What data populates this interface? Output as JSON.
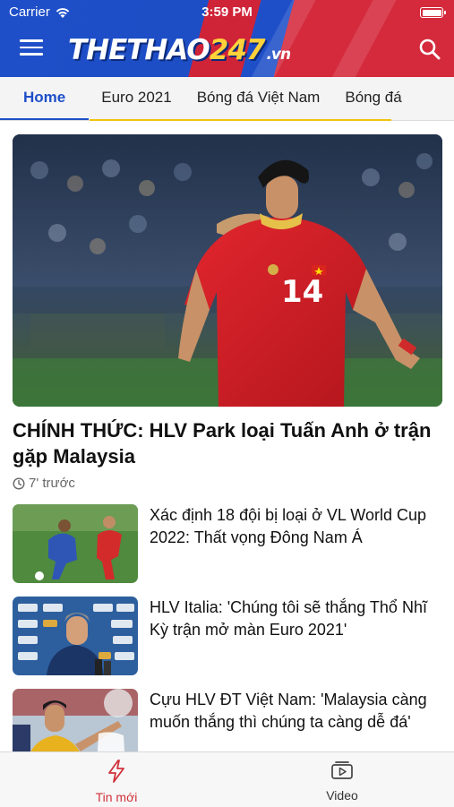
{
  "status_bar": {
    "carrier": "Carrier",
    "time": "3:59 PM"
  },
  "header": {
    "logo_main": "THETHAO",
    "logo_num": "247",
    "logo_tld": ".vn"
  },
  "tabs": [
    {
      "label": "Home",
      "active": true
    },
    {
      "label": "Euro 2021",
      "active": false
    },
    {
      "label": "Bóng đá Việt Nam",
      "active": false
    },
    {
      "label": "Bóng đá",
      "active": false
    }
  ],
  "featured": {
    "title": "CHÍNH THỨC: HLV Park loại Tuấn Anh ở trận gặp Malaysia",
    "time": "7' trước",
    "jersey_number": "14"
  },
  "articles": [
    {
      "title": "Xác định 18 đội bị loại ở VL World Cup 2022: Thất vọng Đông Nam Á"
    },
    {
      "title": "HLV Italia: 'Chúng tôi sẽ thắng Thổ Nhĩ Kỳ trận mở màn Euro 2021'"
    },
    {
      "title": "Cựu HLV ĐT Việt Nam: 'Malaysia càng muốn thắng thì chúng ta càng dễ đá'"
    }
  ],
  "bottom_nav": [
    {
      "label": "Tin mới",
      "icon": "lightning-icon",
      "active": true
    },
    {
      "label": "Video",
      "icon": "video-icon",
      "active": false
    }
  ],
  "colors": {
    "brand_blue": "#1f4fc8",
    "brand_red": "#cf2338",
    "active_nav": "#d0323a",
    "tab_accent_yellow": "#f1c40f"
  }
}
